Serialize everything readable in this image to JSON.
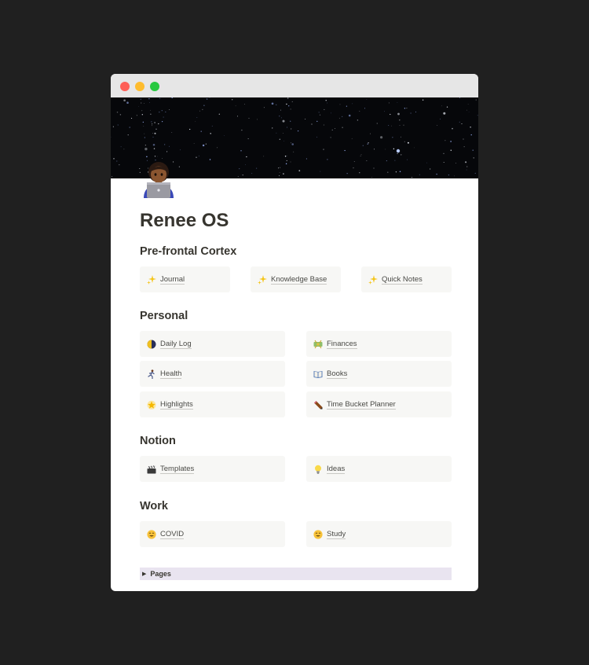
{
  "page": {
    "title": "Renee OS",
    "icon": "woman-technologist-emoji-icon"
  },
  "sections": {
    "prefrontal": {
      "heading": "Pre-frontal Cortex",
      "items": [
        {
          "label": "Journal",
          "icon": "sparkles-icon"
        },
        {
          "label": "Knowledge Base",
          "icon": "sparkles-icon"
        },
        {
          "label": "Quick Notes",
          "icon": "sparkles-icon"
        }
      ]
    },
    "personal": {
      "heading": "Personal",
      "items": [
        {
          "label": "Daily Log",
          "icon": "moon-icon"
        },
        {
          "label": "Finances",
          "icon": "money-icon"
        },
        {
          "label": "Health",
          "icon": "runner-icon"
        },
        {
          "label": "Books",
          "icon": "book-icon"
        },
        {
          "label": "Highlights",
          "icon": "glowing-star-icon"
        },
        {
          "label": "Time Bucket Planner",
          "icon": "pencil-icon"
        }
      ]
    },
    "notion": {
      "heading": "Notion",
      "items": [
        {
          "label": "Templates",
          "icon": "clapper-icon"
        },
        {
          "label": "Ideas",
          "icon": "lightbulb-icon"
        }
      ]
    },
    "work": {
      "heading": "Work",
      "items": [
        {
          "label": "COVID",
          "icon": "smiley-icon"
        },
        {
          "label": "Study",
          "icon": "smiley-icon"
        }
      ]
    }
  },
  "toggle": {
    "label": "Pages",
    "arrow": "▶"
  },
  "colors": {
    "background": "#202020",
    "card": "#f7f7f5",
    "toggle_bg": "#e9e4f0",
    "text": "#37352f"
  }
}
